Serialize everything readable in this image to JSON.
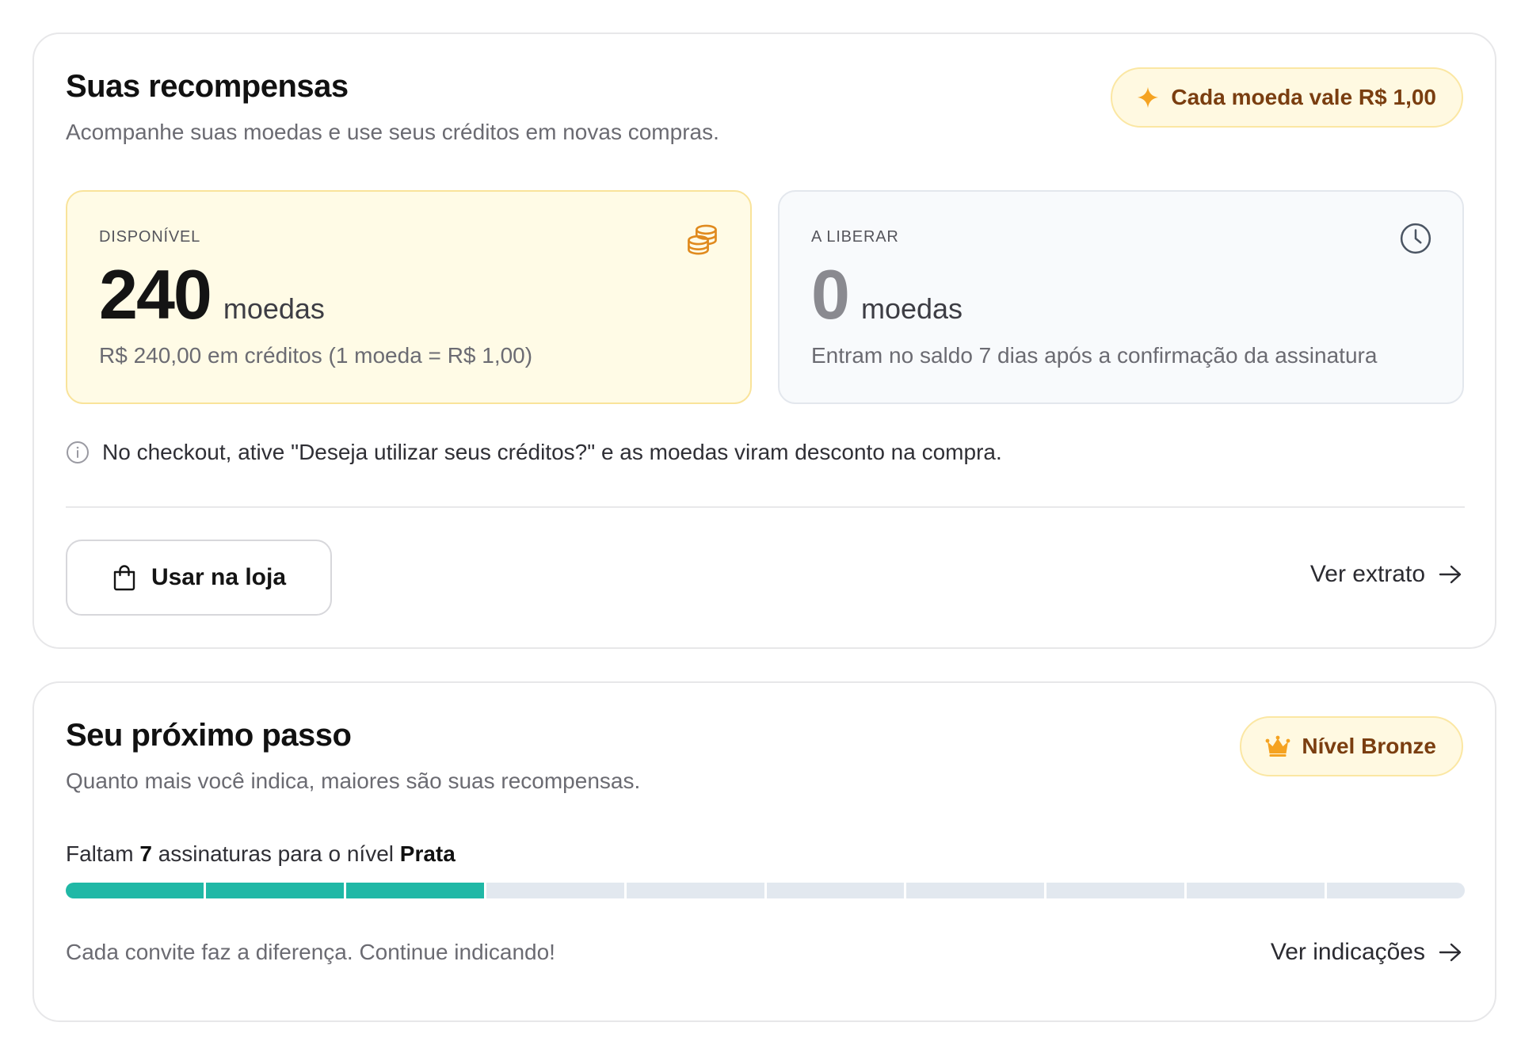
{
  "rewards": {
    "title": "Suas recompensas",
    "subtitle": "Acompanhe suas moedas e use seus créditos em novas compras.",
    "coin_value_badge": "Cada moeda vale R$ 1,00",
    "available": {
      "label": "DISPONÍVEL",
      "amount": "240",
      "unit": "moedas",
      "note": "R$ 240,00 em créditos (1 moeda = R$ 1,00)"
    },
    "pending": {
      "label": "A LIBERAR",
      "amount": "0",
      "unit": "moedas",
      "note": "Entram no saldo 7 dias após a confirmação da assinatura"
    },
    "info": "No checkout, ative \"Deseja utilizar seus créditos?\" e as moedas viram desconto na compra.",
    "store_button_label": "Usar na loja",
    "statement_link_label": "Ver extrato"
  },
  "next_step": {
    "title": "Seu próximo passo",
    "subtitle": "Quanto mais você indica, maiores são suas recompensas.",
    "level_badge": "Nível Bronze",
    "progress_prefix": "Faltam",
    "remaining": "7",
    "progress_middle": "assinaturas para o nível",
    "next_level": "Prata",
    "progress": {
      "completed": 3,
      "total": 10
    },
    "footer_text": "Cada convite faz a diferença. Continue indicando!",
    "referrals_link_label": "Ver indicações"
  },
  "colors": {
    "accent_gold": "#f5a321",
    "badge_text": "#7a3e10",
    "progress_fill": "#20b8a6",
    "progress_empty": "#e2e8ef"
  },
  "icons": {
    "coin_badge": "sparkle-icon",
    "available": "coins-stack-icon",
    "pending": "clock-icon",
    "info": "info-icon",
    "store": "shopping-bag-icon",
    "link": "arrow-right-icon",
    "level": "crown-icon"
  }
}
